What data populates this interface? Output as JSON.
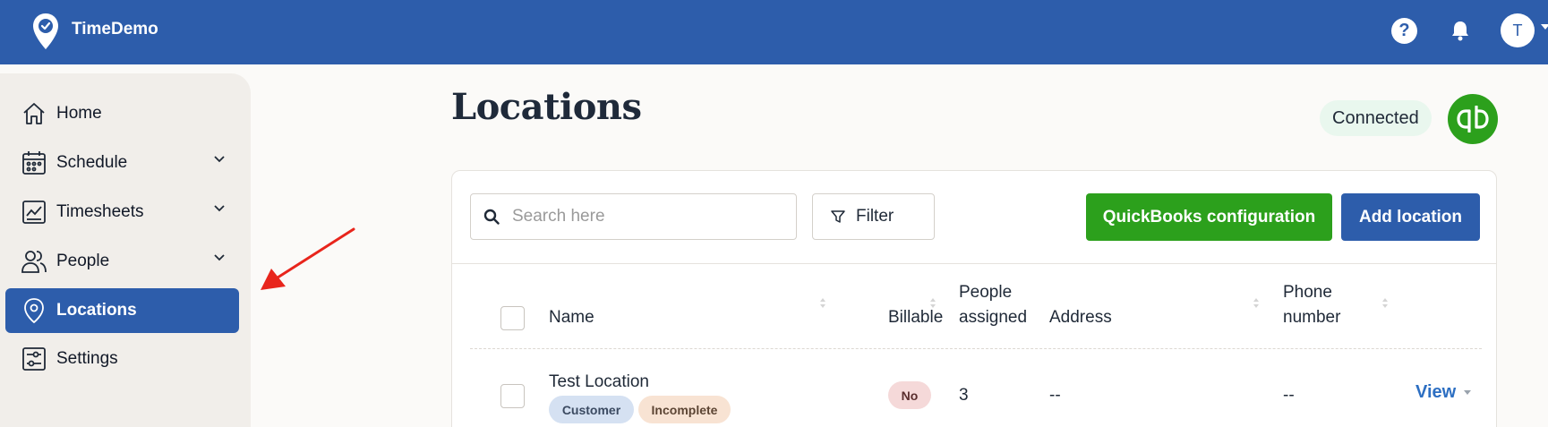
{
  "app": {
    "name": "TimeDemo",
    "user_initial": "T"
  },
  "icons": {
    "logo": "location-check-icon",
    "help": "question-icon",
    "bell": "bell-icon",
    "search": "search-icon",
    "filter": "filter-icon",
    "quickbooks": "quickbooks-logo"
  },
  "sidebar": {
    "items": [
      {
        "label": "Home",
        "icon": "home-icon",
        "has_chevron": false,
        "active": false
      },
      {
        "label": "Schedule",
        "icon": "calendar-icon",
        "has_chevron": true,
        "active": false
      },
      {
        "label": "Timesheets",
        "icon": "timesheet-icon",
        "has_chevron": true,
        "active": false
      },
      {
        "label": "People",
        "icon": "people-icon",
        "has_chevron": true,
        "active": false
      },
      {
        "label": "Locations",
        "icon": "location-pin-icon",
        "has_chevron": false,
        "active": true
      },
      {
        "label": "Settings",
        "icon": "settings-sliders-icon",
        "has_chevron": false,
        "active": false
      }
    ]
  },
  "page": {
    "title": "Locations",
    "connection_status": "Connected"
  },
  "toolbar": {
    "search_placeholder": "Search here",
    "filter_label": "Filter",
    "qb_config_label": "QuickBooks configuration",
    "add_label": "Add location"
  },
  "table": {
    "columns": {
      "name": "Name",
      "billable": "Billable",
      "people_1": "People",
      "people_2": "assigned",
      "address": "Address",
      "phone_1": "Phone",
      "phone_2": "number"
    },
    "rows": [
      {
        "name": "Test Location",
        "tags": [
          "Customer",
          "Incomplete"
        ],
        "billable": "No",
        "people_assigned": "3",
        "address": "--",
        "phone": "--",
        "action": "View"
      }
    ]
  },
  "colors": {
    "primary": "#2d5dab",
    "quickbooks_green": "#2ca01c",
    "sidebar_bg": "#f1eeea",
    "annotation_arrow": "#e8251c"
  }
}
